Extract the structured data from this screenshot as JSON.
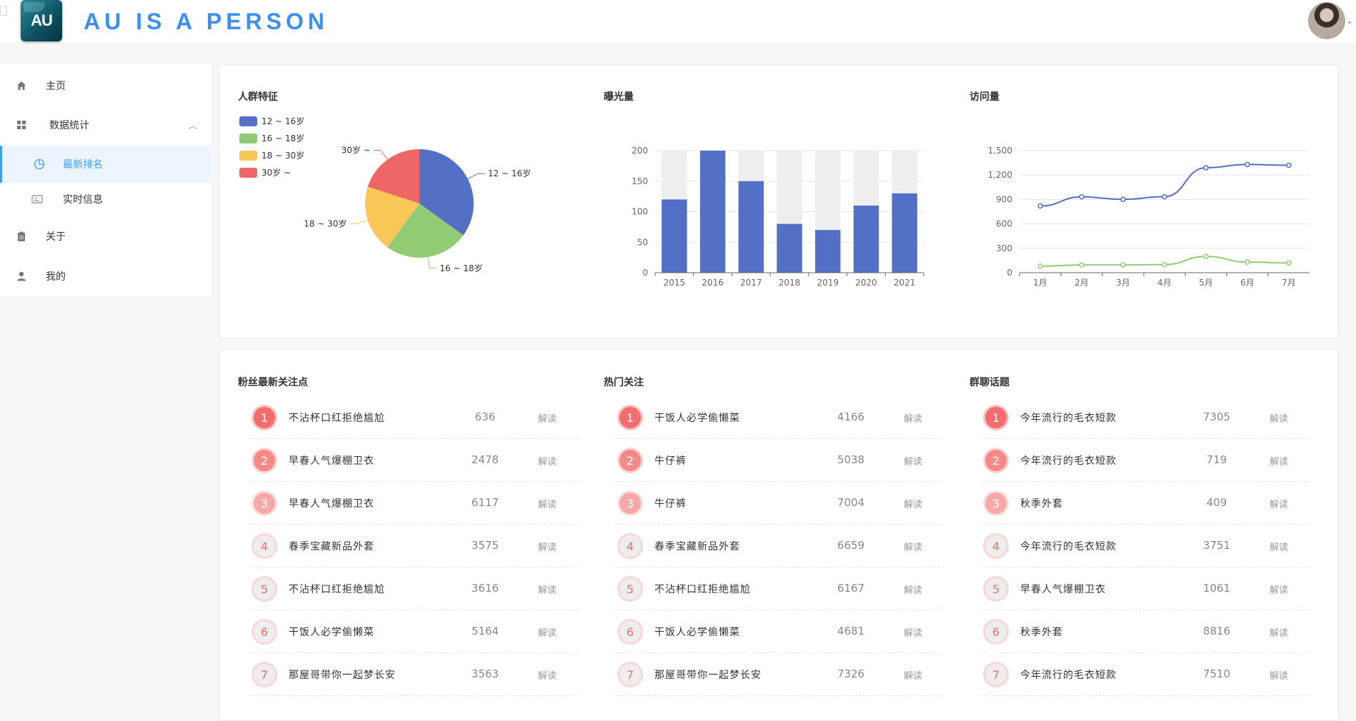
{
  "header": {
    "logo_text": "AU",
    "brand": "AU IS A PERSON"
  },
  "sidebar": {
    "items": [
      {
        "label": "主页",
        "icon": "home-icon"
      },
      {
        "label": "数据统计",
        "icon": "grid-icon"
      },
      {
        "label": "最新排名",
        "icon": "pie-chart-icon"
      },
      {
        "label": "实时信息",
        "icon": "id-card-icon"
      },
      {
        "label": "关于",
        "icon": "clipboard-icon"
      },
      {
        "label": "我的",
        "icon": "user-icon"
      }
    ]
  },
  "charts": {
    "crowd": {
      "title": "人群特征"
    },
    "exposure": {
      "title": "曝光量"
    },
    "visits": {
      "title": "访问量"
    }
  },
  "chart_data": [
    {
      "type": "pie",
      "title": "人群特征",
      "legend_placement": "top-left",
      "categories": [
        "12 ~ 16岁",
        "16 ~ 18岁",
        "18 ~ 30岁",
        "30岁 ~"
      ],
      "values": [
        35,
        25,
        20,
        20
      ],
      "colors": [
        "#5470c6",
        "#91cc75",
        "#fac858",
        "#ee6666"
      ]
    },
    {
      "type": "bar",
      "title": "曝光量",
      "categories": [
        "2015",
        "2016",
        "2017",
        "2018",
        "2019",
        "2020",
        "2021"
      ],
      "values": [
        120,
        200,
        150,
        80,
        70,
        110,
        130
      ],
      "background_max": 200,
      "ylim": [
        0,
        200
      ],
      "yticks": [
        0,
        50,
        100,
        150,
        200
      ],
      "color": "#5470c6"
    },
    {
      "type": "line",
      "title": "访问量",
      "categories": [
        "1月",
        "2月",
        "3月",
        "4月",
        "5月",
        "6月",
        "7月"
      ],
      "series": [
        {
          "values": [
            820,
            932,
            901,
            934,
            1290,
            1330,
            1320
          ],
          "color": "#5470c6"
        },
        {
          "values": [
            80,
            95,
            95,
            100,
            200,
            130,
            120
          ],
          "color": "#91cc75"
        }
      ],
      "ylim": [
        0,
        1500
      ],
      "yticks": [
        "0",
        "300",
        "600",
        "900",
        "1,200",
        "1,500"
      ],
      "grid": true
    }
  ],
  "lists": [
    {
      "title": "粉丝最新关注点",
      "action_label": "解读",
      "rows": [
        {
          "rank": "1",
          "name": "不沾杯口红拒绝尴尬",
          "value": "636"
        },
        {
          "rank": "2",
          "name": "早春人气爆棚卫衣",
          "value": "2478"
        },
        {
          "rank": "3",
          "name": "早春人气爆棚卫衣",
          "value": "6117"
        },
        {
          "rank": "4",
          "name": "春季宝藏新品外套",
          "value": "3575"
        },
        {
          "rank": "5",
          "name": "不沾杯口红拒绝尴尬",
          "value": "3616"
        },
        {
          "rank": "6",
          "name": "干饭人必学偷懒菜",
          "value": "5164"
        },
        {
          "rank": "7",
          "name": "那屋哥带你一起梦长安",
          "value": "3563"
        }
      ]
    },
    {
      "title": "热门关注",
      "action_label": "解读",
      "rows": [
        {
          "rank": "1",
          "name": "干饭人必学偷懒菜",
          "value": "4166"
        },
        {
          "rank": "2",
          "name": "牛仔裤",
          "value": "5038"
        },
        {
          "rank": "3",
          "name": "牛仔裤",
          "value": "7004"
        },
        {
          "rank": "4",
          "name": "春季宝藏新品外套",
          "value": "6659"
        },
        {
          "rank": "5",
          "name": "不沾杯口红拒绝尴尬",
          "value": "6167"
        },
        {
          "rank": "6",
          "name": "干饭人必学偷懒菜",
          "value": "4681"
        },
        {
          "rank": "7",
          "name": "那屋哥带你一起梦长安",
          "value": "7326"
        }
      ]
    },
    {
      "title": "群聊话题",
      "action_label": "解读",
      "rows": [
        {
          "rank": "1",
          "name": "今年流行的毛衣短款",
          "value": "7305"
        },
        {
          "rank": "2",
          "name": "今年流行的毛衣短款",
          "value": "719"
        },
        {
          "rank": "3",
          "name": "秋季外套",
          "value": "409"
        },
        {
          "rank": "4",
          "name": "今年流行的毛衣短款",
          "value": "3751"
        },
        {
          "rank": "5",
          "name": "早春人气爆棚卫衣",
          "value": "1061"
        },
        {
          "rank": "6",
          "name": "秋季外套",
          "value": "8816"
        },
        {
          "rank": "7",
          "name": "今年流行的毛衣短款",
          "value": "7510"
        }
      ]
    }
  ],
  "colors": {
    "accent": "#409eff",
    "brand": "#3b8ff5",
    "badge_top": "#f56c6c"
  }
}
